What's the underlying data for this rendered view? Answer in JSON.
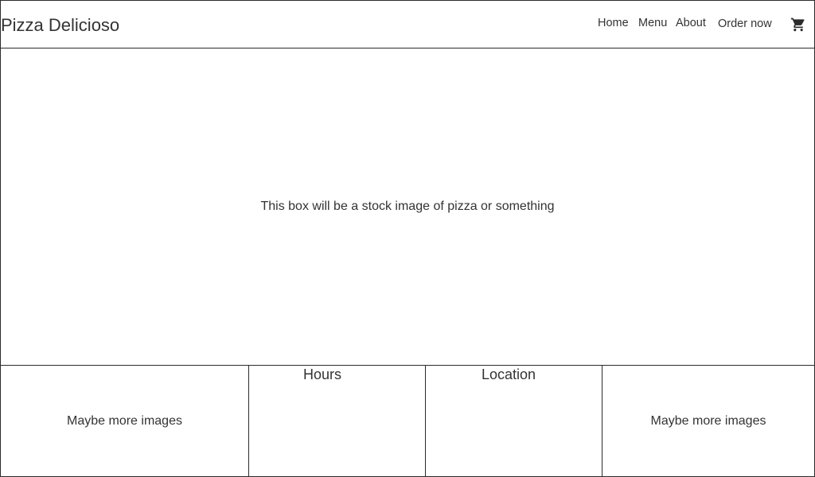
{
  "header": {
    "brand": "Pizza Delicioso",
    "nav": {
      "home": "Home",
      "menu": "Menu",
      "about": "About"
    },
    "order_now": "Order now",
    "cart_icon": "shopping-cart-icon"
  },
  "hero": {
    "text": "This box will be a stock image of pizza or something"
  },
  "bottom": {
    "left_text": "Maybe more images",
    "hours_heading": "Hours",
    "location_heading": "Location",
    "right_text": "Maybe more images"
  },
  "colors": {
    "border": "#2b2b2b",
    "text": "#333333",
    "background": "#ffffff"
  }
}
